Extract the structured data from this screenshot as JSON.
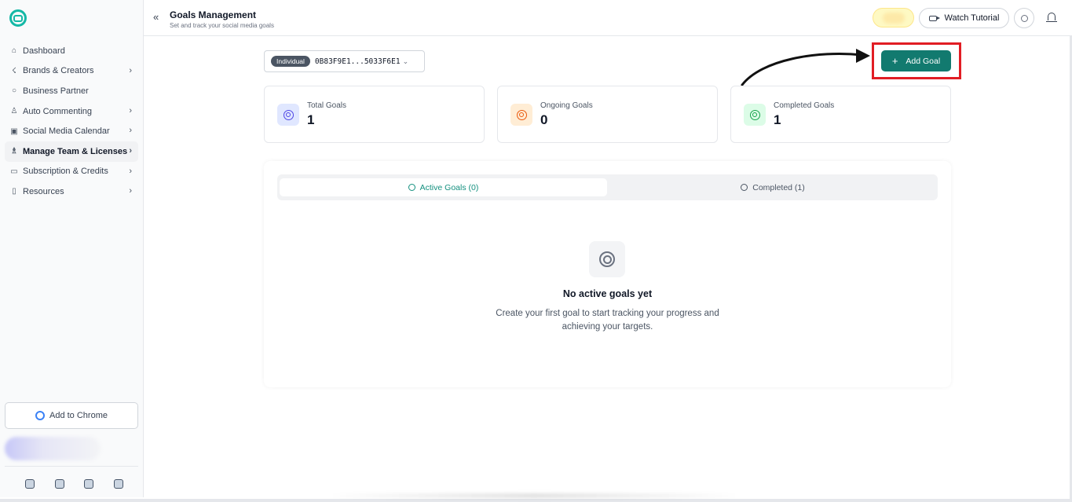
{
  "sidebar": {
    "items": [
      {
        "label": "Dashboard",
        "icon": "home-icon",
        "chevron": false
      },
      {
        "label": "Brands & Creators",
        "icon": "brand-icon",
        "chevron": true
      },
      {
        "label": "Business Partner",
        "icon": "chat-bubble-icon",
        "chevron": false
      },
      {
        "label": "Auto Commenting",
        "icon": "bot-icon",
        "chevron": true
      },
      {
        "label": "Social Media Calendar",
        "icon": "calendar-icon",
        "chevron": true
      },
      {
        "label": "Manage Team & Licenses",
        "icon": "team-icon",
        "chevron": true
      },
      {
        "label": "Subscription & Credits",
        "icon": "credit-card-icon",
        "chevron": true
      },
      {
        "label": "Resources",
        "icon": "book-icon",
        "chevron": true
      }
    ],
    "add_to_chrome": "Add to Chrome"
  },
  "header": {
    "title": "Goals Management",
    "subtitle": "Set and track your social media goals",
    "watch_tutorial": "Watch Tutorial"
  },
  "account": {
    "badge": "Individual",
    "id": "0B83F9E1...5033F6E1"
  },
  "actions": {
    "add_goal": "Add Goal"
  },
  "stats": [
    {
      "label": "Total Goals",
      "value": "1",
      "color": "#4f46e5",
      "bg": "#e0e7ff"
    },
    {
      "label": "Ongoing Goals",
      "value": "0",
      "color": "#ea580c",
      "bg": "#ffedd5"
    },
    {
      "label": "Completed Goals",
      "value": "1",
      "color": "#16a34a",
      "bg": "#dcfce7"
    }
  ],
  "tabs": {
    "active": "Active Goals (0)",
    "completed": "Completed (1)"
  },
  "empty_state": {
    "title": "No active goals yet",
    "description": "Create your first goal to start tracking your progress and achieving your targets."
  },
  "colors": {
    "accent": "#127a6f",
    "highlight": "#e11d24"
  }
}
